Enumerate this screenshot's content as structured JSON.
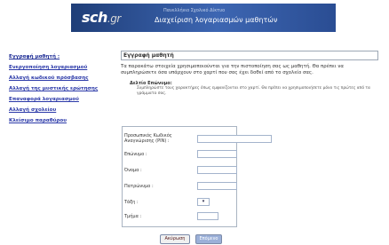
{
  "header": {
    "logo": "sch",
    "logo_ext": ".gr",
    "org": "Πανελλήνιο Σχολικό Δίκτυο",
    "app_title": "Διαχείριση λογαριασμών μαθητών"
  },
  "sidebar": {
    "items": [
      {
        "label": "Εγγραφή μαθητή :"
      },
      {
        "label": "Ενεργοποίηση λογαριασμού"
      },
      {
        "label": "Αλλαγή κωδικού πρόσβασης"
      },
      {
        "label": "Αλλαγή της μυστικής ερώτησης"
      },
      {
        "label": "Επαναφορά λογαριασμού"
      },
      {
        "label": "Αλλαγή σχολείου"
      },
      {
        "label": "Κλείσιμο παραθύρου"
      }
    ]
  },
  "main": {
    "title": "Εγγραφή μαθητή",
    "intro": "Τα παρακάτω στοιχεία χρησιμοποιούνται για την πιστοποίηση σας ως μαθητή. Θα πρέπει να συμπληρώσετε όσα υπάρχουν στο χαρτί που σας έχει δοθεί από το σχολείο σας.",
    "bullet_title": "Δελτίο Επώνυμο:",
    "bullet_text": "Συμπληρώστε τους χαρακτήρες όπως εμφανίζονται στο χαρτί. Θα πρέπει να χρησιμοποιήσετε μόνο τις πρώτες από τα γράμματα σας."
  },
  "form": {
    "fields": [
      {
        "label": "Προσωπικός Κωδικός Αναγνώρισης (PIN) :"
      },
      {
        "label": "Επώνυμο :"
      },
      {
        "label": "Όνομα :"
      },
      {
        "label": "Πατρώνυμο :"
      },
      {
        "label": "Τάξη :",
        "value": "▾"
      },
      {
        "label": "Τμήμα :"
      }
    ]
  },
  "buttons": {
    "back": "Ακύρωση",
    "next": "Επόμενο"
  },
  "colors": {
    "banner": "#2a4d93",
    "link": "#2a38a8",
    "button_primary": "#9bb0d8"
  }
}
